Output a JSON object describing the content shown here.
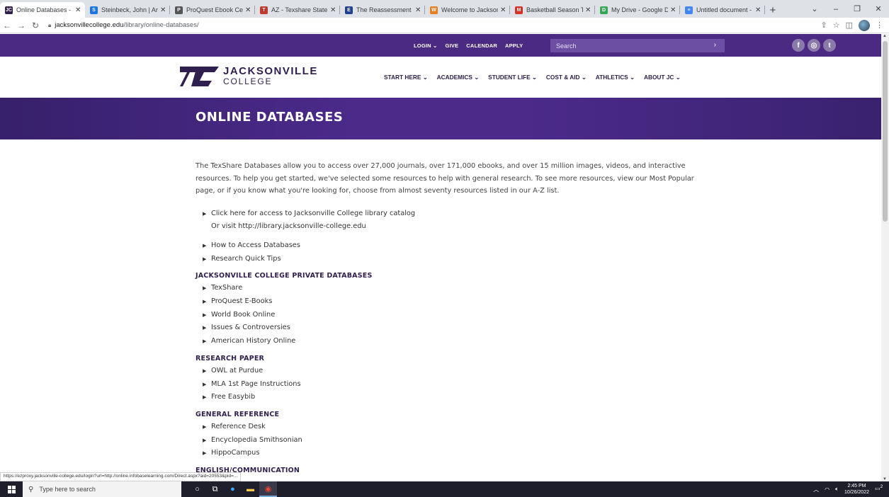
{
  "browser": {
    "tabs": [
      {
        "title": "Online Databases - Ja",
        "fav": "JC",
        "color": "#2e1f4f",
        "active": true
      },
      {
        "title": "Steinbeck, John | Artic",
        "fav": "S",
        "color": "#1a73e8",
        "active": false
      },
      {
        "title": "ProQuest Ebook Centr",
        "fav": "P",
        "color": "#555555",
        "active": false
      },
      {
        "title": "AZ - Texshare State Lib",
        "fav": "T",
        "color": "#c0392b",
        "active": false
      },
      {
        "title": "The Reassessment of",
        "fav": "E",
        "color": "#1f3f8f",
        "active": false
      },
      {
        "title": "Welcome to Jacksonv",
        "fav": "W",
        "color": "#e67e22",
        "active": false
      },
      {
        "title": "Basketball Season Tick",
        "fav": "M",
        "color": "#d93025",
        "active": false
      },
      {
        "title": "My Drive - Google Dri",
        "fav": "D",
        "color": "#34a853",
        "active": false
      },
      {
        "title": "Untitled document - G",
        "fav": "≡",
        "color": "#4285f4",
        "active": false
      }
    ],
    "new_tab": "+",
    "url_host": "jacksonvillecollege.edu",
    "url_path": "/library/online-databases/"
  },
  "site": {
    "util_links": [
      "LOGIN ⌄",
      "GIVE",
      "CALENDAR",
      "APPLY"
    ],
    "search_placeholder": "Search",
    "search_go": "›",
    "social": [
      "f",
      "◎",
      "t"
    ],
    "logo_line1": "JACKSONVILLE",
    "logo_line2": "COLLEGE",
    "nav": [
      "START HERE ⌄",
      "ACADEMICS ⌄",
      "STUDENT LIFE ⌄",
      "COST & AID ⌄",
      "ATHLETICS ⌄",
      "ABOUT JC ⌄"
    ],
    "page_title": "ONLINE DATABASES"
  },
  "content": {
    "intro": "The TexShare Databases allow you to access over 27,000 journals, over 171,000 ebooks, and over 15 million images, videos, and interactive resources. To help you get started, we've selected some resources to help with general research. To see more resources, view our Most Popular page, or if you know what you're looking for, choose from almost seventy resources listed in our A-Z list.",
    "catalog_link": "Click here for access to Jacksonville College library catalog",
    "catalog_sub": "Or visit http://library.jacksonville-college.edu",
    "help_links": [
      "How to Access Databases",
      "Research Quick Tips"
    ],
    "sections": [
      {
        "heading": "JACKSONVILLE COLLEGE PRIVATE DATABASES",
        "items": [
          "TexShare",
          "ProQuest E-Books",
          "World Book Online",
          "Issues & Controversies",
          "American History Online"
        ]
      },
      {
        "heading": "RESEARCH PAPER",
        "items": [
          "OWL at Purdue",
          "MLA 1st Page Instructions",
          "Free Easybib"
        ]
      },
      {
        "heading": "GENERAL REFERENCE",
        "items": [
          "Reference Desk",
          "Encyclopedia Smithsonian",
          "HippoCampus"
        ]
      },
      {
        "heading": "ENGLISH/COMMUNICATION",
        "items": []
      }
    ]
  },
  "status_url": "https://ezproxy.jacksonville-college.edu/login?url=http://online.infobaselearning.com/Direct.aspx?aid=20553&pid=...",
  "taskbar": {
    "search_placeholder": "Type here to search",
    "time": "2:45 PM",
    "date": "10/26/2022",
    "notif_count": "2"
  }
}
